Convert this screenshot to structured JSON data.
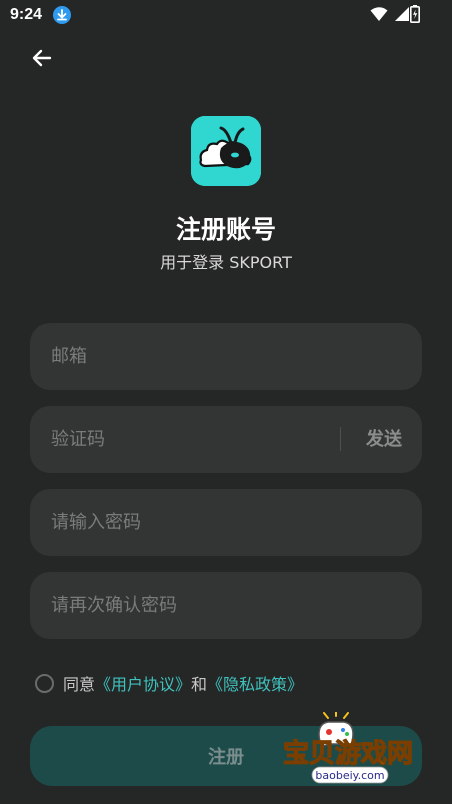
{
  "status_bar": {
    "time": "9:24",
    "icons": [
      "download-icon",
      "wifi-icon",
      "signal-icon",
      "battery-icon"
    ]
  },
  "header": {
    "back_icon": "arrow-left-icon"
  },
  "brand": {
    "title": "注册账号",
    "subtitle": "用于登录 SKPORT",
    "logo_color": "#2fd7d0"
  },
  "form": {
    "email_placeholder": "邮箱",
    "code_placeholder": "验证码",
    "send_label": "发送",
    "password_placeholder": "请输入密码",
    "confirm_placeholder": "请再次确认密码"
  },
  "agreement": {
    "prefix": "同意",
    "user_agreement": "《用户协议》",
    "and": "和",
    "privacy_policy": "《隐私政策》"
  },
  "register": {
    "label": "注册"
  },
  "watermark": {
    "title": "宝贝游戏网",
    "url": "baobeiy.com"
  },
  "colors": {
    "background": "#252626",
    "field": "#333434",
    "accent": "#3fc2bd",
    "button": "#1c4b49"
  }
}
